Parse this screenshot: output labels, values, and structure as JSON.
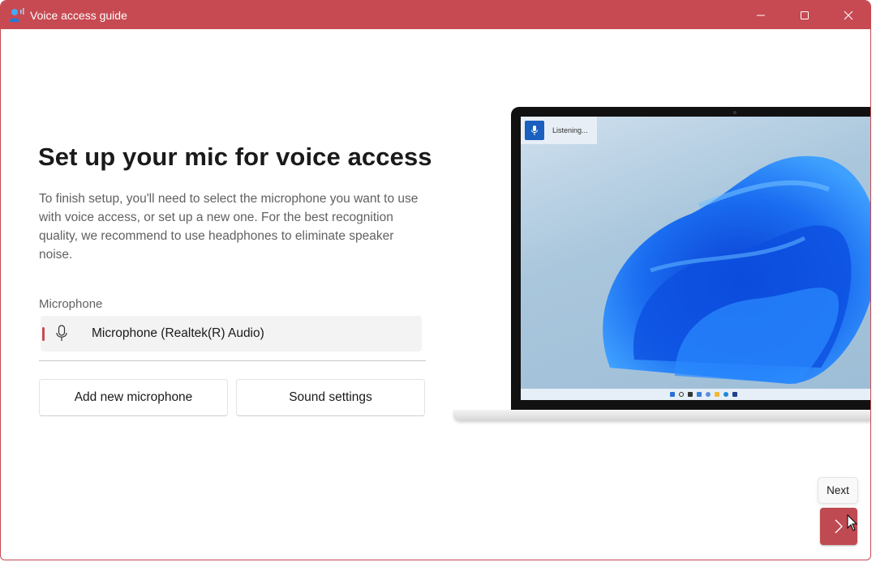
{
  "window": {
    "title": "Voice access guide",
    "accent_color": "#c74a52",
    "controls": {
      "minimize": "minimize-icon",
      "maximize": "maximize-icon",
      "close": "close-icon"
    }
  },
  "main": {
    "heading": "Set up your mic for voice access",
    "description": "To finish setup, you'll need to select the microphone you want to use with voice access, or set up a new one. For the best recognition quality, we recommend to use headphones to eliminate speaker noise.",
    "microphone_label": "Microphone",
    "microphone_selected": "Microphone (Realtek(R) Audio)",
    "buttons": {
      "add_microphone": "Add new microphone",
      "sound_settings": "Sound settings"
    }
  },
  "illustration": {
    "listening_text": "Listening..."
  },
  "navigation": {
    "next_tooltip": "Next",
    "next_icon": "chevron-right-icon"
  }
}
